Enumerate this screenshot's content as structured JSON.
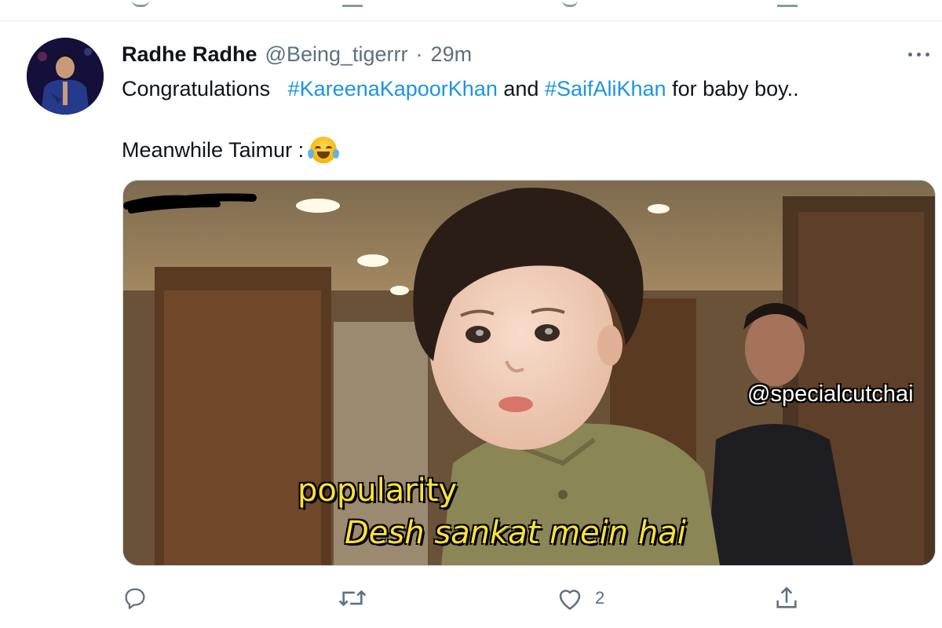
{
  "tweet": {
    "display_name": "Radhe Radhe",
    "handle": "@Being_tigerrr",
    "separator": "·",
    "time": "29m",
    "text_line1": {
      "prefix": "Congratulations",
      "hashtag1": "#KareenaKapoorKhan",
      "middle": "and",
      "hashtag2": "#SaifAliKhan",
      "suffix": "for baby boy.."
    },
    "text_line2": "Meanwhile Taimur :",
    "emoji_icon": "face-with-tears-of-joy-icon",
    "media": {
      "watermark": "@specialcutchai",
      "caption_top": "popularity",
      "caption_bottom": "Desh sankat mein hai"
    },
    "actions": {
      "reply_icon": "reply-icon",
      "retweet_icon": "retweet-icon",
      "like_icon": "heart-icon",
      "like_count": "2",
      "share_icon": "share-icon"
    }
  },
  "colors": {
    "hashtag": "#1b95e0",
    "secondary_text": "#5b7083",
    "caption": "#ffe23a"
  }
}
